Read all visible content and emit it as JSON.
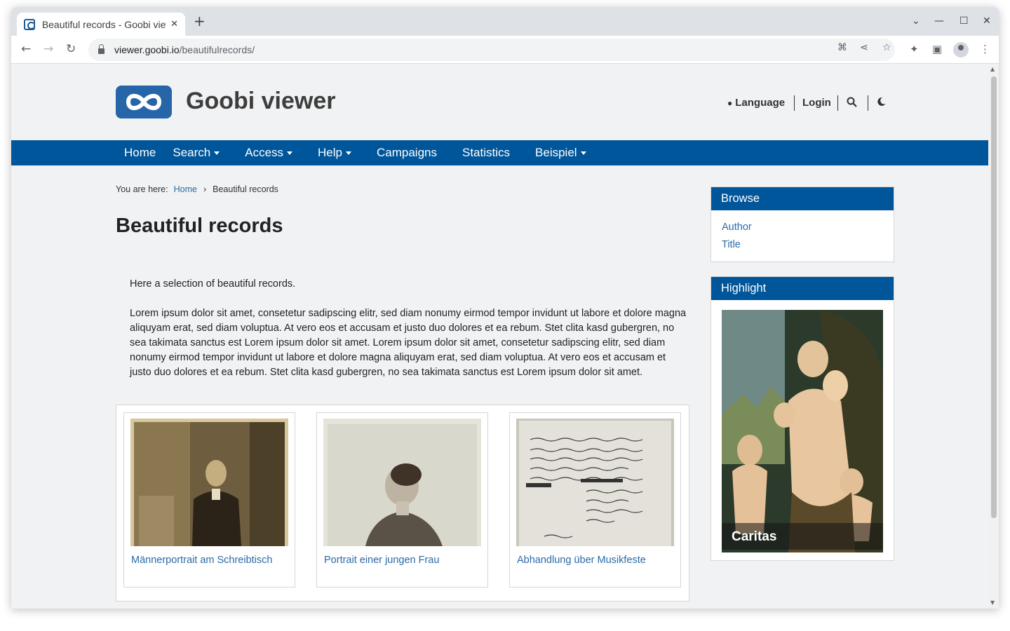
{
  "browser": {
    "tab_title": "Beautiful records - Goobi viewer",
    "tab_close": "✕",
    "new_tab": "+",
    "url_host": "viewer.goobi.io",
    "url_path": "/beautifulrecords/",
    "window_controls": [
      "⌄",
      "—",
      "☐",
      "✕"
    ]
  },
  "header": {
    "site_title": "Goobi viewer",
    "language_label": "Language",
    "login_label": "Login"
  },
  "nav": {
    "items": [
      {
        "label": "Home",
        "dropdown": false
      },
      {
        "label": "Search",
        "dropdown": true
      },
      {
        "label": "Access",
        "dropdown": true
      },
      {
        "label": "Help",
        "dropdown": true
      },
      {
        "label": "Campaigns",
        "dropdown": false
      },
      {
        "label": "Statistics",
        "dropdown": false
      },
      {
        "label": "Beispiel",
        "dropdown": true
      }
    ]
  },
  "breadcrumb": {
    "prefix": "You are here:",
    "home": "Home",
    "separator": "›",
    "current": "Beautiful records"
  },
  "page": {
    "title": "Beautiful records",
    "intro": "Here a selection of beautiful records.",
    "lorem": "Lorem ipsum dolor sit amet, consetetur sadipscing elitr, sed diam nonumy eirmod tempor invidunt ut labore et dolore magna aliquyam erat, sed diam voluptua. At vero eos et accusam et justo duo dolores et ea rebum. Stet clita kasd gubergren, no sea takimata sanctus est Lorem ipsum dolor sit amet. Lorem ipsum dolor sit amet, consetetur sadipscing elitr, sed diam nonumy eirmod tempor invidunt ut labore et dolore magna aliquyam erat, sed diam voluptua. At vero eos et accusam et justo duo dolores et ea rebum. Stet clita kasd gubergren, no sea takimata sanctus est Lorem ipsum dolor sit amet."
  },
  "records": [
    {
      "title": "Männerportrait am Schreibtisch"
    },
    {
      "title": "Portrait einer jungen Frau"
    },
    {
      "title": "Abhandlung über Musikfeste"
    }
  ],
  "sidebar": {
    "browse": {
      "heading": "Browse",
      "links": [
        "Author",
        "Title"
      ]
    },
    "highlight": {
      "heading": "Highlight",
      "caption": "Caritas"
    }
  },
  "colors": {
    "brand_blue": "#00569a",
    "link_blue": "#2a6aa8",
    "page_bg": "#f1f2f4"
  }
}
